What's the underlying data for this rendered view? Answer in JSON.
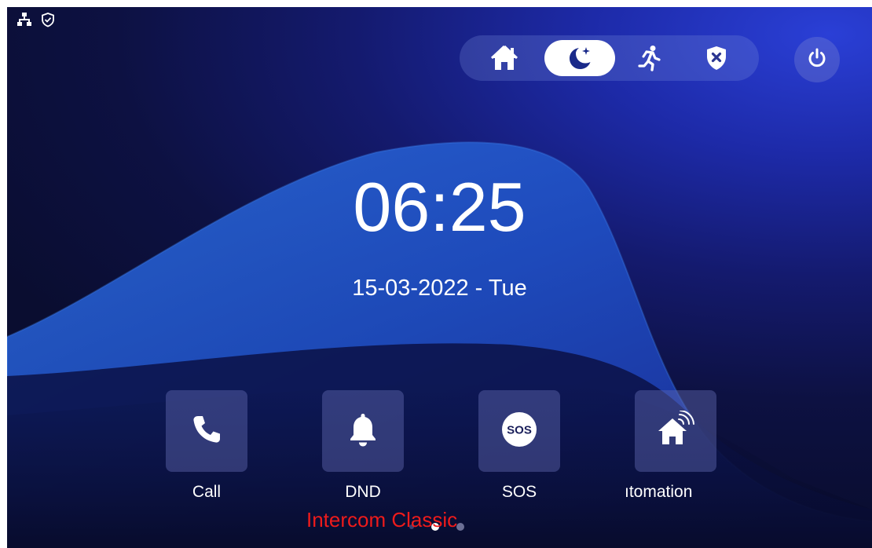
{
  "clock": {
    "time": "06:25",
    "date": "15-03-2022 - Tue"
  },
  "status_icons": [
    "network-icon",
    "shield-check-icon"
  ],
  "modes": [
    {
      "name": "home",
      "icon": "home-icon",
      "active": false
    },
    {
      "name": "night",
      "icon": "moon-star-icon",
      "active": true
    },
    {
      "name": "away",
      "icon": "running-person-icon",
      "active": false
    },
    {
      "name": "disarm",
      "icon": "shield-x-icon",
      "active": false
    }
  ],
  "power_icon": "power-icon",
  "apps": [
    {
      "label": "Call",
      "icon": "phone-icon"
    },
    {
      "label": "DND",
      "icon": "bell-icon"
    },
    {
      "label": "SOS",
      "icon": "sos-icon",
      "icon_text": "SOS"
    },
    {
      "label": "ıtomation",
      "icon": "smart-home-icon"
    }
  ],
  "pager": {
    "pages": 3,
    "active": 1
  },
  "overlay_caption": "Intercom Classic",
  "colors": {
    "accent_white": "#ffffff",
    "caption_red": "#ee1b1b",
    "panel_bg": "#0d1142"
  }
}
